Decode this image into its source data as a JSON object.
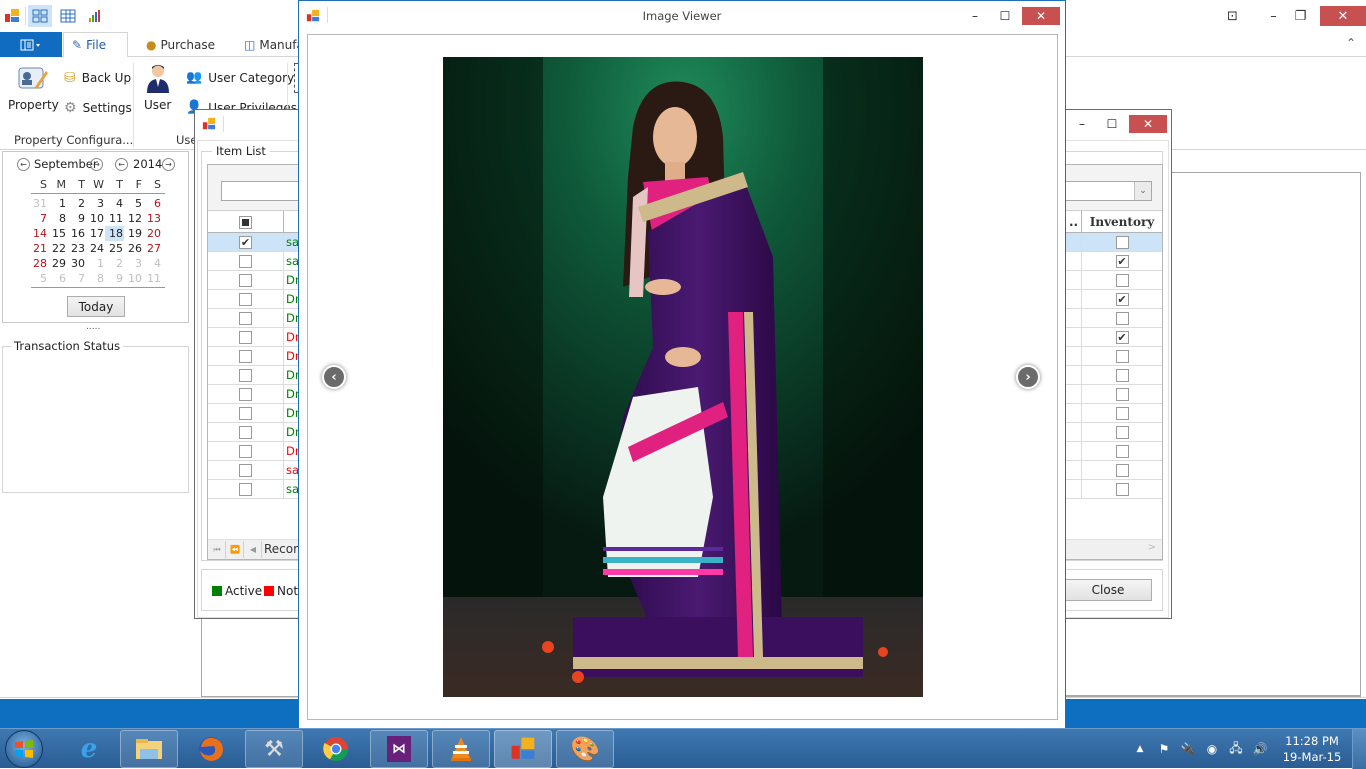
{
  "app": {
    "ribbon": {
      "tabs": [
        {
          "label": "File",
          "selected": true
        },
        {
          "label": "Purchase",
          "selected": false
        },
        {
          "label": "Manufac",
          "selected": false
        }
      ],
      "groups": [
        {
          "label": "Property Configura...",
          "items": [
            "Property",
            "Back Up",
            "Settings"
          ]
        },
        {
          "label": "Use",
          "items": [
            "User",
            "User Category",
            "User Privileges"
          ]
        }
      ]
    },
    "calendar": {
      "month": "September",
      "year": "2014",
      "weekdays": [
        "S",
        "M",
        "T",
        "W",
        "T",
        "F",
        "S"
      ],
      "weeks": [
        [
          "31",
          "1",
          "2",
          "3",
          "4",
          "5",
          "6"
        ],
        [
          "7",
          "8",
          "9",
          "10",
          "11",
          "12",
          "13"
        ],
        [
          "14",
          "15",
          "16",
          "17",
          "18",
          "19",
          "20"
        ],
        [
          "21",
          "22",
          "23",
          "24",
          "25",
          "26",
          "27"
        ],
        [
          "28",
          "29",
          "30",
          "1",
          "2",
          "3",
          "4"
        ],
        [
          "5",
          "6",
          "7",
          "8",
          "9",
          "10",
          "11"
        ]
      ],
      "selected_day": "18",
      "today_button": "Today"
    },
    "splitter_dots": ".....",
    "transaction_status_label": "Transaction Status"
  },
  "item_list_window": {
    "group_label": "Item List",
    "columns": {
      "truncated_header": "..",
      "inventory": "Inventory"
    },
    "rows": [
      {
        "checked": true,
        "name": "sar",
        "status": "active",
        "inventory": false,
        "selected": true
      },
      {
        "checked": false,
        "name": "sar",
        "status": "active",
        "inventory": true,
        "selected": false
      },
      {
        "checked": false,
        "name": "Dre",
        "status": "active",
        "inventory": false,
        "selected": false
      },
      {
        "checked": false,
        "name": "Dre",
        "status": "active",
        "inventory": true,
        "selected": false
      },
      {
        "checked": false,
        "name": "Dre",
        "status": "active",
        "inventory": false,
        "selected": false
      },
      {
        "checked": false,
        "name": "Dre",
        "status": "inactive",
        "inventory": true,
        "selected": false
      },
      {
        "checked": false,
        "name": "Dre",
        "status": "inactive",
        "inventory": false,
        "selected": false
      },
      {
        "checked": false,
        "name": "Dre",
        "status": "active",
        "inventory": false,
        "selected": false
      },
      {
        "checked": false,
        "name": "Dre",
        "status": "active",
        "inventory": false,
        "selected": false
      },
      {
        "checked": false,
        "name": "Dre",
        "status": "active",
        "inventory": false,
        "selected": false
      },
      {
        "checked": false,
        "name": "Dre",
        "status": "active",
        "inventory": false,
        "selected": false
      },
      {
        "checked": false,
        "name": "Dre",
        "status": "inactive",
        "inventory": false,
        "selected": false
      },
      {
        "checked": false,
        "name": "sar",
        "status": "inactive",
        "inventory": false,
        "selected": false
      },
      {
        "checked": false,
        "name": "sar",
        "status": "active",
        "inventory": false,
        "selected": false
      }
    ],
    "pager_label": "Record",
    "legend": [
      {
        "label": "Active",
        "color": "#008000"
      },
      {
        "label": "Not A",
        "color": "#ff0000"
      }
    ],
    "close_button": "Close"
  },
  "image_viewer": {
    "title": "Image Viewer",
    "prev_icon": "chevron-left-icon",
    "next_icon": "chevron-right-icon",
    "image_description": "Model wearing a purple velvet and white saree with pink floral border on a green background"
  },
  "taskbar": {
    "apps": [
      "Internet Explorer",
      "Windows Explorer",
      "Firefox",
      "Tools",
      "Chrome",
      "Visual Studio",
      "VLC",
      "Application",
      "Paint"
    ],
    "clock_time": "11:28 PM",
    "clock_date": "19-Mar-15"
  },
  "colors": {
    "active": "#008000",
    "inactive": "#ff0000",
    "accent": "#0f6cc0",
    "close_red": "#c75050",
    "selection": "#cde3f7"
  }
}
